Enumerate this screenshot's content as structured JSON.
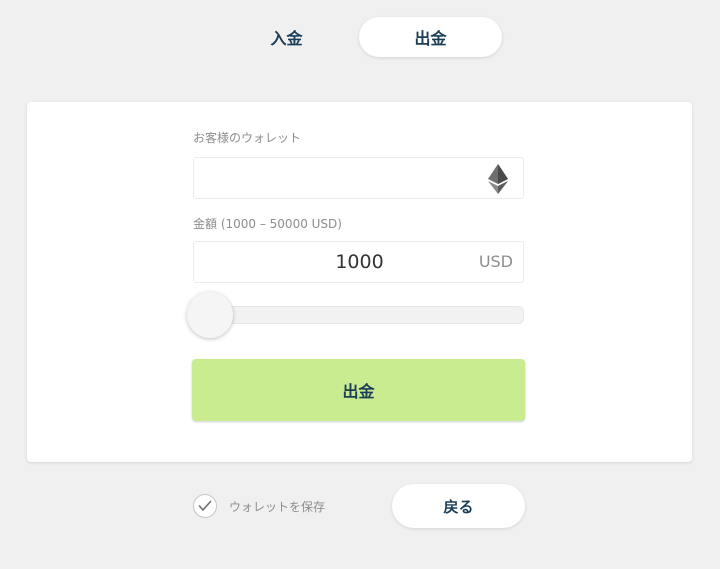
{
  "tabs": {
    "deposit_label": "入金",
    "withdraw_label": "出金",
    "active": "withdraw"
  },
  "form": {
    "wallet_label": "お客様のウォレット",
    "wallet_value": "",
    "wallet_icon": "ethereum-icon",
    "amount_label": "金額 (1000 – 50000 USD)",
    "amount_value": "1000",
    "amount_unit": "USD",
    "amount_min": 1000,
    "amount_max": 50000,
    "slider_fraction": 0,
    "submit_label": "出金"
  },
  "footer": {
    "save_wallet_label": "ウォレットを保存",
    "save_wallet_checked": true,
    "back_label": "戻る"
  },
  "colors": {
    "background": "#f0f0f0",
    "card": "#ffffff",
    "primary_text": "#1c3d57",
    "muted_text": "#8d8d8d",
    "submit_bg": "#c8ec8f"
  }
}
